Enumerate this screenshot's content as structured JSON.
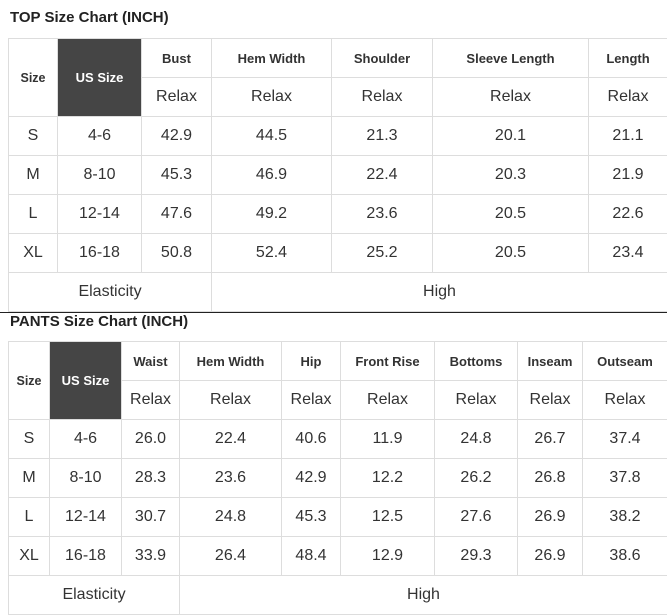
{
  "top": {
    "title": "TOP Size Chart (INCH)",
    "size_label": "Size",
    "us_size_label": "US Size",
    "columns": [
      "Bust",
      "Hem Width",
      "Shoulder",
      "Sleeve Length",
      "Length"
    ],
    "fit": [
      "Relax",
      "Relax",
      "Relax",
      "Relax",
      "Relax"
    ],
    "rows": [
      {
        "size": "S",
        "us": "4-6",
        "values": [
          "42.9",
          "44.5",
          "21.3",
          "20.1",
          "21.1"
        ]
      },
      {
        "size": "M",
        "us": "8-10",
        "values": [
          "45.3",
          "46.9",
          "22.4",
          "20.3",
          "21.9"
        ]
      },
      {
        "size": "L",
        "us": "12-14",
        "values": [
          "47.6",
          "49.2",
          "23.6",
          "20.5",
          "22.6"
        ]
      },
      {
        "size": "XL",
        "us": "16-18",
        "values": [
          "50.8",
          "52.4",
          "25.2",
          "20.5",
          "23.4"
        ]
      }
    ],
    "elasticity_label": "Elasticity",
    "elasticity_value": "High"
  },
  "pants": {
    "title": "PANTS Size Chart (INCH)",
    "size_label": "Size",
    "us_size_label": "US Size",
    "columns": [
      "Waist",
      "Hem Width",
      "Hip",
      "Front Rise",
      "Bottoms",
      "Inseam",
      "Outseam"
    ],
    "fit": [
      "Relax",
      "Relax",
      "Relax",
      "Relax",
      "Relax",
      "Relax",
      "Relax"
    ],
    "rows": [
      {
        "size": "S",
        "us": "4-6",
        "values": [
          "26.0",
          "22.4",
          "40.6",
          "11.9",
          "24.8",
          "26.7",
          "37.4"
        ]
      },
      {
        "size": "M",
        "us": "8-10",
        "values": [
          "28.3",
          "23.6",
          "42.9",
          "12.2",
          "26.2",
          "26.8",
          "37.8"
        ]
      },
      {
        "size": "L",
        "us": "12-14",
        "values": [
          "30.7",
          "24.8",
          "45.3",
          "12.5",
          "27.6",
          "26.9",
          "38.2"
        ]
      },
      {
        "size": "XL",
        "us": "16-18",
        "values": [
          "33.9",
          "26.4",
          "48.4",
          "12.9",
          "29.3",
          "26.9",
          "38.6"
        ]
      }
    ],
    "elasticity_label": "Elasticity",
    "elasticity_value": "High"
  },
  "colors": {
    "header_dark": "#454545",
    "border": "#dddddd",
    "text": "#333333"
  }
}
